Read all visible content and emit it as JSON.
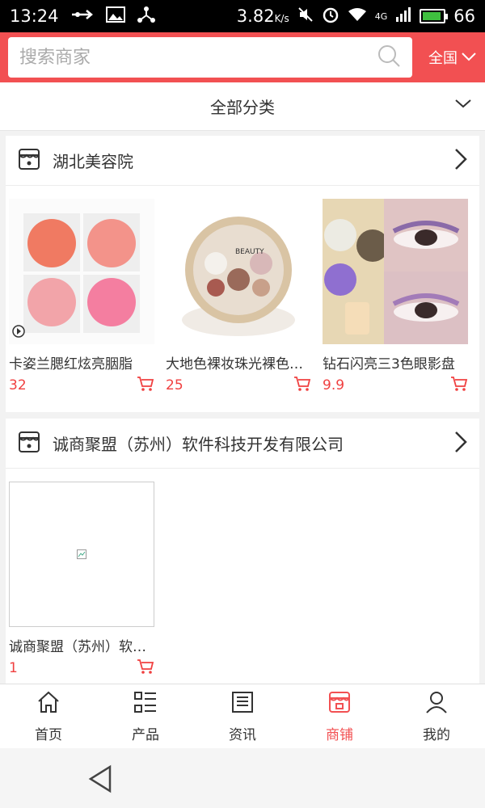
{
  "status_bar": {
    "time": "13:24",
    "speed": "3.82",
    "speed_unit": "K/s",
    "network": "4G",
    "battery": "66"
  },
  "search": {
    "placeholder": "搜索商家"
  },
  "region": {
    "label": "全国"
  },
  "category": {
    "label": "全部分类"
  },
  "shops": [
    {
      "name": "湖北美容院",
      "products": [
        {
          "name": "卡姿兰腮红炫亮胭脂",
          "price": "32"
        },
        {
          "name": "大地色裸妆珠光裸色眼影",
          "price": "25"
        },
        {
          "name": "钻石闪亮三3色眼影盘",
          "price": "9.9"
        }
      ]
    },
    {
      "name": "诚商聚盟（苏州）软件科技开发有限公司",
      "products": [
        {
          "name": "诚商聚盟（苏州）软件科技",
          "price": "1"
        }
      ]
    }
  ],
  "nav": [
    {
      "label": "首页",
      "icon": "home-icon"
    },
    {
      "label": "产品",
      "icon": "list-icon"
    },
    {
      "label": "资讯",
      "icon": "news-icon"
    },
    {
      "label": "商铺",
      "icon": "store-icon",
      "active": true
    },
    {
      "label": "我的",
      "icon": "user-icon"
    }
  ],
  "colors": {
    "brand": "#f25052",
    "price": "#f04040"
  }
}
